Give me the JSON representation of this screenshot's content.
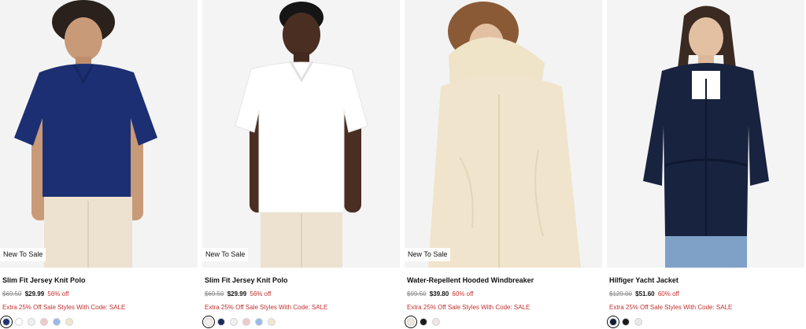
{
  "products": [
    {
      "badge": "New To Sale",
      "title": "Slim Fit Jersey Knit Polo",
      "original_price": "$69.50",
      "sale_price": "$29.99",
      "discount": "56% off",
      "promo": "Extra 25% Off Sale Styles With Code: SALE",
      "swatches": [
        "#1f3470",
        "#ffffff",
        "#efefef",
        "#f1c9cc",
        "#9ab9ea",
        "#efe7cf"
      ],
      "selected_swatch": 0
    },
    {
      "badge": "New To Sale",
      "title": "Slim Fit Jersey Knit Polo",
      "original_price": "$69.50",
      "sale_price": "$29.99",
      "discount": "56% off",
      "promo": "Extra 25% Off Sale Styles With Code: SALE",
      "swatches": [
        "#f3f0e8",
        "#1c2b5e",
        "#f1f1f1",
        "#f1c9cc",
        "#9ab9ea",
        "#efe7cf"
      ],
      "selected_swatch": 0
    },
    {
      "badge": "New To Sale",
      "title": "Water-Repellent Hooded Windbreaker",
      "original_price": "$99.50",
      "sale_price": "$39.80",
      "discount": "60% off",
      "promo": "Extra 25% Off Sale Styles With Code: SALE",
      "swatches": [
        "#efe7d8",
        "#1a1a1a",
        "#f4e3e2"
      ],
      "selected_swatch": 0
    },
    {
      "badge": "",
      "title": "Hilfiger Yacht Jacket",
      "original_price": "$129.00",
      "sale_price": "$51.60",
      "discount": "60% off",
      "promo": "Extra 25% Off Sale Styles With Code: SALE",
      "swatches": [
        "#0f1c33",
        "#1b1b1b",
        "#e8e8e8"
      ],
      "selected_swatch": 0
    }
  ]
}
